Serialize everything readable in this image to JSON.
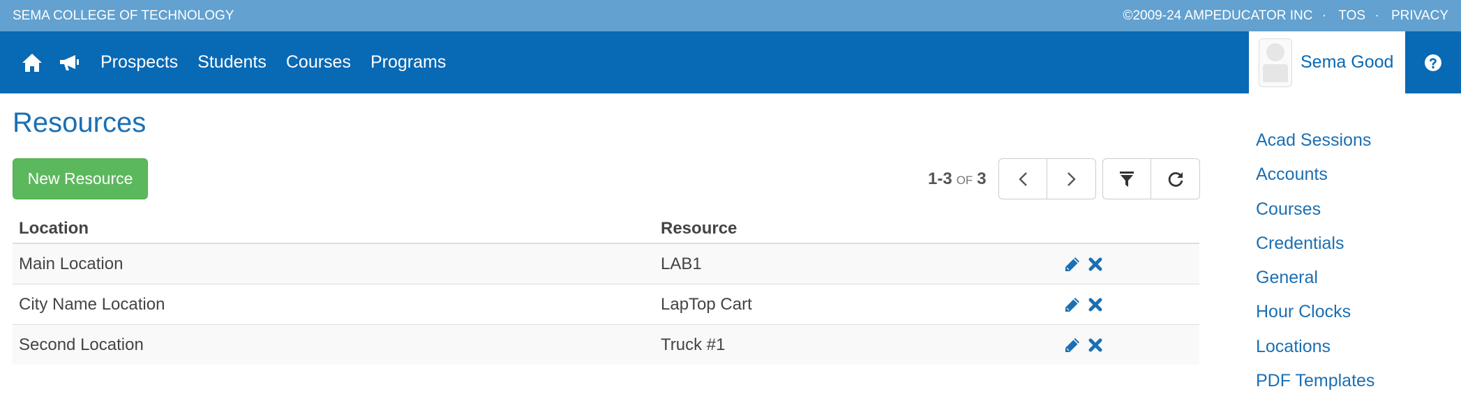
{
  "topbar": {
    "school": "SEMA COLLEGE OF TECHNOLOGY",
    "copyright": "©2009-24 AMPEDUCATOR INC",
    "tos": "TOS",
    "privacy": "PRIVACY",
    "separator": "·"
  },
  "nav": {
    "home_icon": "home-icon",
    "announce_icon": "megaphone-icon",
    "links": [
      "Prospects",
      "Students",
      "Courses",
      "Programs"
    ],
    "user_name": "Sema Good",
    "help_icon": "question-circle-icon",
    "brand_color": "#0869b5"
  },
  "main": {
    "title": "Resources",
    "new_button": "New Resource",
    "pager": {
      "range": "1-3",
      "of": "OF",
      "total": "3"
    },
    "table": {
      "headers": [
        "Location",
        "Resource",
        ""
      ],
      "rows": [
        {
          "location": "Main Location",
          "resource": "LAB1"
        },
        {
          "location": "City Name Location",
          "resource": "LapTop Cart"
        },
        {
          "location": "Second Location",
          "resource": "Truck #1"
        }
      ]
    }
  },
  "sidebar": {
    "items": [
      "Acad Sessions",
      "Accounts",
      "Courses",
      "Credentials",
      "General",
      "Hour Clocks",
      "Locations",
      "PDF Templates"
    ]
  }
}
